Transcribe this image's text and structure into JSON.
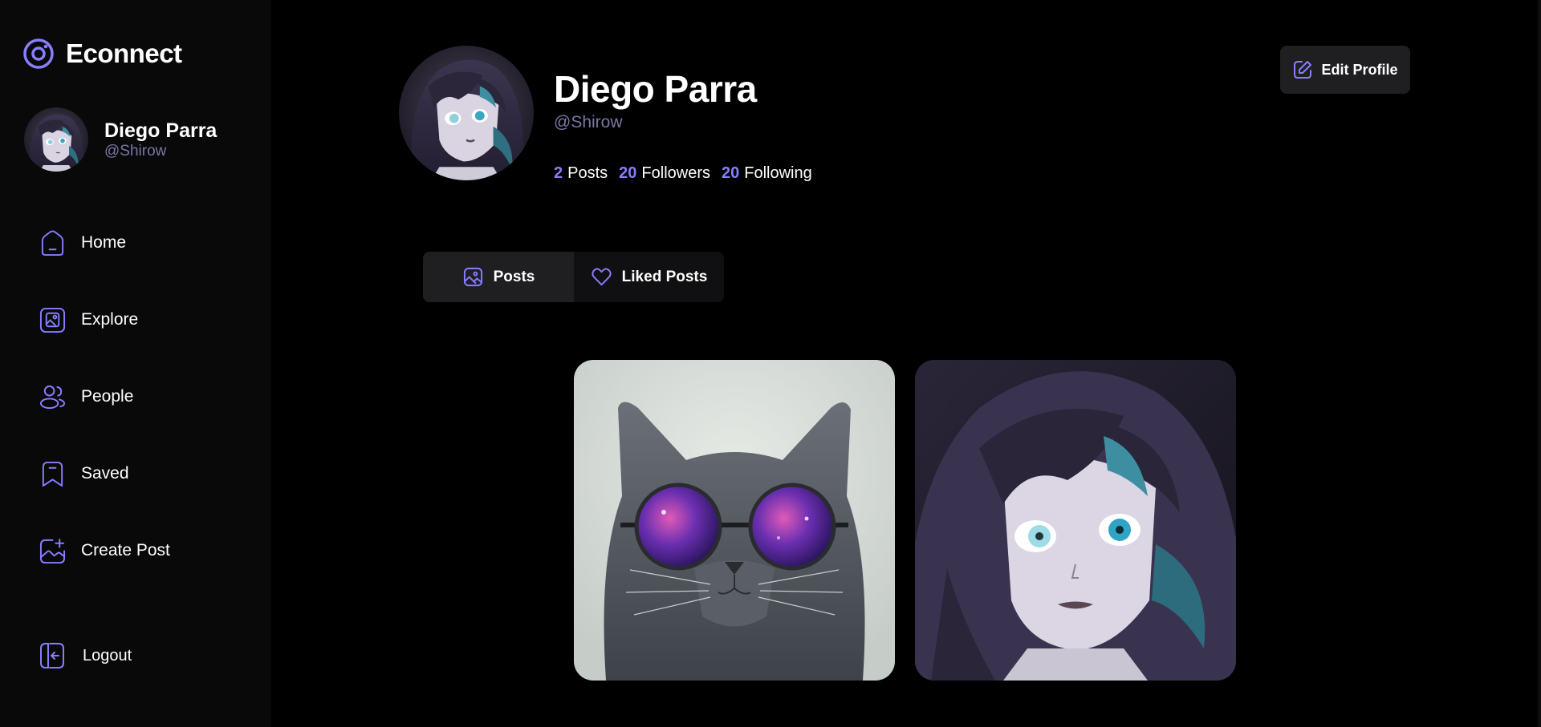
{
  "app": {
    "name": "Econnect",
    "logo_icon": "camera-ring-icon",
    "accent": "#877EFF"
  },
  "current_user": {
    "name": "Diego Parra",
    "handle": "@Shirow"
  },
  "sidebar": {
    "items": [
      {
        "label": "Home",
        "icon": "home-icon"
      },
      {
        "label": "Explore",
        "icon": "gallery-icon"
      },
      {
        "label": "People",
        "icon": "people-icon"
      },
      {
        "label": "Saved",
        "icon": "bookmark-icon"
      },
      {
        "label": "Create Post",
        "icon": "add-image-icon"
      }
    ],
    "logout_label": "Logout"
  },
  "profile": {
    "name": "Diego Parra",
    "handle": "@Shirow",
    "stats": [
      {
        "value": "2",
        "label": "Posts"
      },
      {
        "value": "20",
        "label": "Followers"
      },
      {
        "value": "20",
        "label": "Following"
      }
    ],
    "edit_label": "Edit Profile"
  },
  "tabs": [
    {
      "label": "Posts",
      "icon": "posts-icon",
      "active": true
    },
    {
      "label": "Liked Posts",
      "icon": "heart-icon",
      "active": false
    }
  ],
  "posts": [
    {
      "subject": "cat-with-galaxy-sunglasses"
    },
    {
      "subject": "anime-girl-portrait"
    }
  ]
}
